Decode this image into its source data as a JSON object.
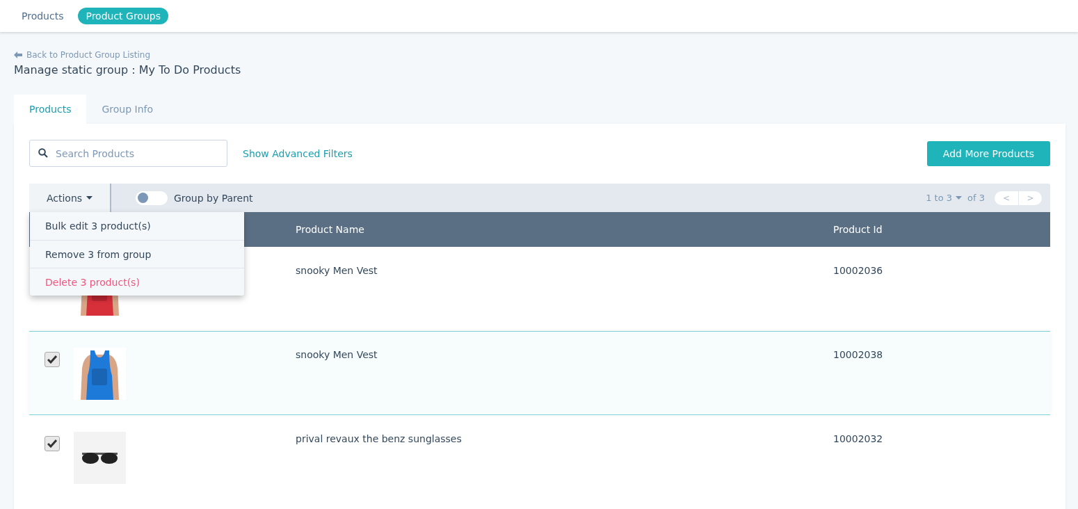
{
  "top_nav": [
    {
      "label": "Products",
      "selected": false
    },
    {
      "label": "Product Groups",
      "selected": true
    }
  ],
  "back_link": "Back to Product Group Listing",
  "page_title": "Manage static group : My To Do Products",
  "tabs": [
    {
      "label": "Products",
      "selected": true
    },
    {
      "label": "Group Info",
      "selected": false
    }
  ],
  "search": {
    "placeholder": "Search Products"
  },
  "advanced_filters_link": "Show Advanced Filters",
  "add_button": "Add More Products",
  "toolbar": {
    "actions_label": "Actions",
    "group_by_parent": {
      "label": "Group by Parent",
      "on": false
    },
    "page_range": "1 to 3",
    "page_total": "of 3",
    "prev": "<",
    "next": ">"
  },
  "actions_menu": [
    {
      "label": "Bulk edit 3 product(s)",
      "kind": "normal"
    },
    {
      "label": "Remove 3 from group",
      "kind": "normal"
    },
    {
      "label": "Delete 3 product(s)",
      "kind": "danger"
    }
  ],
  "table": {
    "columns": [
      "Product Name",
      "Product Id"
    ],
    "rows": [
      {
        "name": "snooky Men Vest",
        "id": "10002036",
        "highlighted": false
      },
      {
        "checked": true,
        "name": "snooky Men Vest",
        "id": "10002038",
        "highlighted": true
      },
      {
        "checked": true,
        "name": "prival revaux the benz sunglasses",
        "id": "10002032",
        "highlighted": false
      }
    ]
  }
}
